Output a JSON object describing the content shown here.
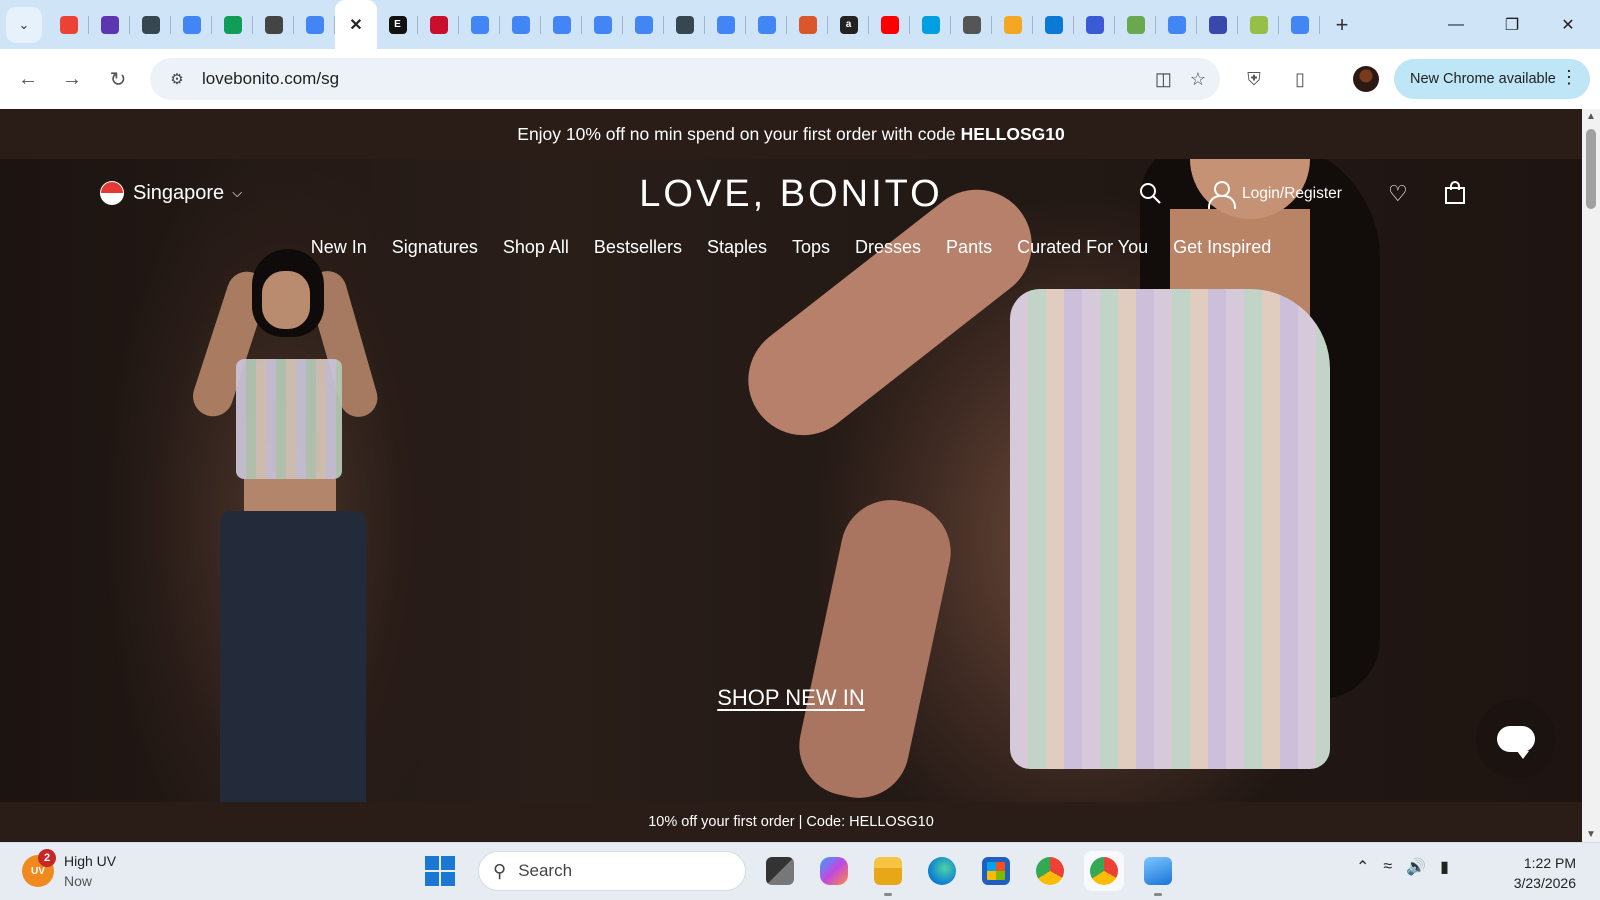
{
  "browser": {
    "tab_search_icon": "chevron-down-icon",
    "tabs": [
      {
        "favicon": "gmail",
        "color": "#ea4335"
      },
      {
        "favicon": "list-circle",
        "color": "#5e35b1"
      },
      {
        "favicon": "chess",
        "color": "#37474f"
      },
      {
        "favicon": "docs",
        "color": "#4285f4"
      },
      {
        "favicon": "sheets-plus",
        "color": "#0f9d58"
      },
      {
        "favicon": "openai",
        "color": "#444444"
      },
      {
        "favicon": "docs",
        "color": "#4285f4"
      },
      {
        "favicon": "close",
        "color": "#ffffff",
        "active": true
      },
      {
        "favicon": "E",
        "color": "#111111"
      },
      {
        "favicon": "red-logo",
        "color": "#c8102e"
      },
      {
        "favicon": "docs",
        "color": "#4285f4"
      },
      {
        "favicon": "docs",
        "color": "#4285f4"
      },
      {
        "favicon": "docs",
        "color": "#4285f4"
      },
      {
        "favicon": "docs",
        "color": "#4285f4"
      },
      {
        "favicon": "globe-list",
        "color": "#4285f4"
      },
      {
        "favicon": "compass",
        "color": "#37474f"
      },
      {
        "favicon": "globe-list",
        "color": "#4285f4"
      },
      {
        "favicon": "globe-list",
        "color": "#4285f4"
      },
      {
        "favicon": "asterisk",
        "color": "#d9572b"
      },
      {
        "favicon": "amazon",
        "color": "#222222"
      },
      {
        "favicon": "youtube",
        "color": "#ff0000"
      },
      {
        "favicon": "play",
        "color": "#00a0e0"
      },
      {
        "favicon": "amazon-music",
        "color": "#555555"
      },
      {
        "favicon": "orange-ring",
        "color": "#f5a623"
      },
      {
        "favicon": "edge-e",
        "color": "#0a7ad6"
      },
      {
        "favicon": "printer",
        "color": "#3b5bd6"
      },
      {
        "favicon": "leaf",
        "color": "#6aa84f"
      },
      {
        "favicon": "google-g",
        "color": "#4285f4"
      },
      {
        "favicon": "gem",
        "color": "#3949ab"
      },
      {
        "favicon": "shopify",
        "color": "#95bf47"
      },
      {
        "favicon": "google-g",
        "color": "#4285f4"
      }
    ],
    "new_tab_label": "+",
    "url": "lovebonito.com/sg",
    "update_label": "New Chrome available"
  },
  "site": {
    "promo_text": "Enjoy 10% off no min spend on your first order with code",
    "promo_code": "HELLOSG10",
    "region": "Singapore",
    "logo": "LOVE, BONITO",
    "login_label": "Login/Register",
    "nav": [
      "New In",
      "Signatures",
      "Shop All",
      "Bestsellers",
      "Staples",
      "Tops",
      "Dresses",
      "Pants",
      "Curated For You",
      "Get Inspired"
    ],
    "cta": "SHOP NEW IN",
    "bottom_banner": "10% off your first order | Code: HELLOSG10"
  },
  "taskbar": {
    "weather_title": "High UV",
    "weather_sub": "Now",
    "weather_badge": "2",
    "weather_icon_text": "UV",
    "search_placeholder": "Search",
    "time": "1:22 PM",
    "date": "3/23/2026"
  }
}
